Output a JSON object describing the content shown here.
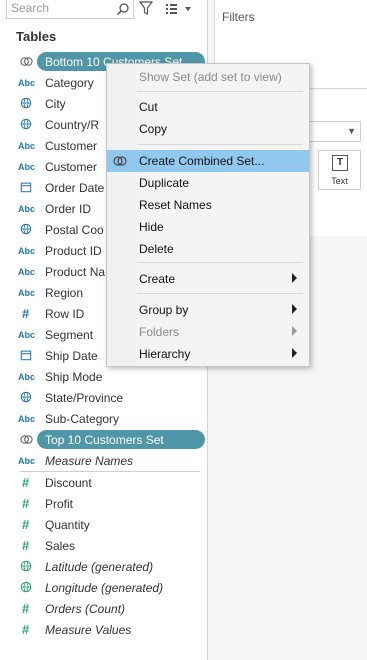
{
  "search": {
    "placeholder": "Search"
  },
  "data_pane": {
    "tables_heading": "Tables",
    "fields": [
      {
        "name": "Bottom 10 Customers Set",
        "type": "set"
      },
      {
        "name": "Category",
        "type": "abc"
      },
      {
        "name": "City",
        "type": "geo"
      },
      {
        "name": "Country/R",
        "type": "geo"
      },
      {
        "name": "Customer",
        "type": "abc"
      },
      {
        "name": "Customer",
        "type": "abc"
      },
      {
        "name": "Order Date",
        "type": "date"
      },
      {
        "name": "Order ID",
        "type": "abc"
      },
      {
        "name": "Postal Coo",
        "type": "geo"
      },
      {
        "name": "Product ID",
        "type": "abc"
      },
      {
        "name": "Product Na",
        "type": "abc"
      },
      {
        "name": "Region",
        "type": "abc"
      },
      {
        "name": "Row ID",
        "type": "number"
      },
      {
        "name": "Segment",
        "type": "abc"
      },
      {
        "name": "Ship Date",
        "type": "date"
      },
      {
        "name": "Ship Mode",
        "type": "abc"
      },
      {
        "name": "State/Province",
        "type": "geo"
      },
      {
        "name": "Sub-Category",
        "type": "abc"
      },
      {
        "name": "Top 10 Customers Set",
        "type": "set"
      },
      {
        "name": "Measure Names",
        "type": "abc"
      },
      {
        "name": "Discount",
        "type": "number"
      },
      {
        "name": "Profit",
        "type": "number"
      },
      {
        "name": "Quantity",
        "type": "number"
      },
      {
        "name": "Sales",
        "type": "number"
      },
      {
        "name": "Latitude (generated)",
        "type": "geo"
      },
      {
        "name": "Longitude (generated)",
        "type": "geo"
      },
      {
        "name": "Orders (Count)",
        "type": "number"
      },
      {
        "name": "Measure Values",
        "type": "number"
      }
    ]
  },
  "filters_card": {
    "title": "Filters"
  },
  "marks_card": {
    "text_button": "Text"
  },
  "context_menu": {
    "items": [
      {
        "label": "Show Set (add set to view)",
        "disabled": true
      },
      {
        "label": "Cut"
      },
      {
        "label": "Copy"
      },
      {
        "label": "Create Combined Set...",
        "highlighted": true
      },
      {
        "label": "Duplicate"
      },
      {
        "label": "Reset Names"
      },
      {
        "label": "Hide"
      },
      {
        "label": "Delete"
      },
      {
        "label": "Create",
        "submenu": true
      },
      {
        "label": "Group by",
        "submenu": true
      },
      {
        "label": "Folders",
        "submenu": true,
        "disabled": true
      },
      {
        "label": "Hierarchy",
        "submenu": true
      }
    ]
  },
  "colors": {
    "set_pill": "#4f97a8",
    "menu_highlight": "#91c8f0",
    "dimension_icon": "#1f77b4",
    "measure_icon": "#2aa86f"
  }
}
